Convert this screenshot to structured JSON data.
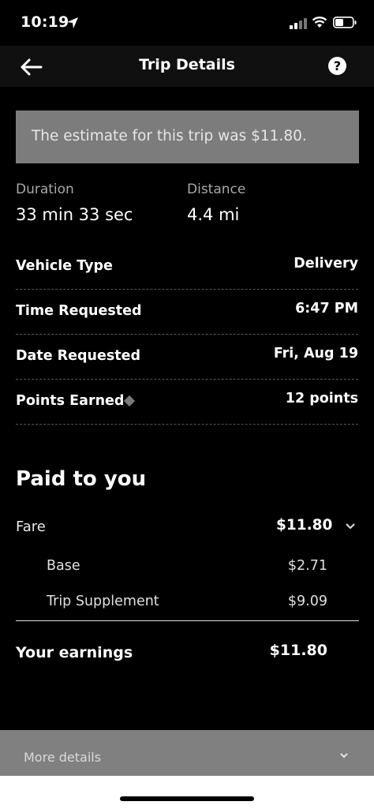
{
  "status": {
    "time": "10:19"
  },
  "header": {
    "title": "Trip Details",
    "help_icon": "question-icon"
  },
  "banner": {
    "text": "The estimate for this trip was $11.80."
  },
  "metrics": [
    {
      "label": "Duration",
      "value": "33 min 33 sec"
    },
    {
      "label": "Distance",
      "value": "4.4 mi"
    }
  ],
  "details": [
    {
      "label": "Vehicle Type",
      "value": "Delivery"
    },
    {
      "label": "Time Requested",
      "value": "6:47 PM"
    },
    {
      "label": "Date Requested",
      "value": "Fri, Aug 19"
    },
    {
      "label": "Points Earned",
      "value": "12 points"
    }
  ],
  "paid": {
    "title": "Paid to you",
    "fare_label": "Fare",
    "fare_value": "$11.80",
    "items": [
      {
        "label": "Base",
        "value": "$2.71"
      },
      {
        "label": "Trip Supplement",
        "value": "$9.09"
      }
    ],
    "earnings_label": "Your earnings",
    "earnings_value": "$11.80"
  },
  "footer": {
    "more_label": "More details"
  },
  "colors": {
    "banner": "#7c7c7c",
    "footer": "#808080",
    "background": "#000000"
  }
}
